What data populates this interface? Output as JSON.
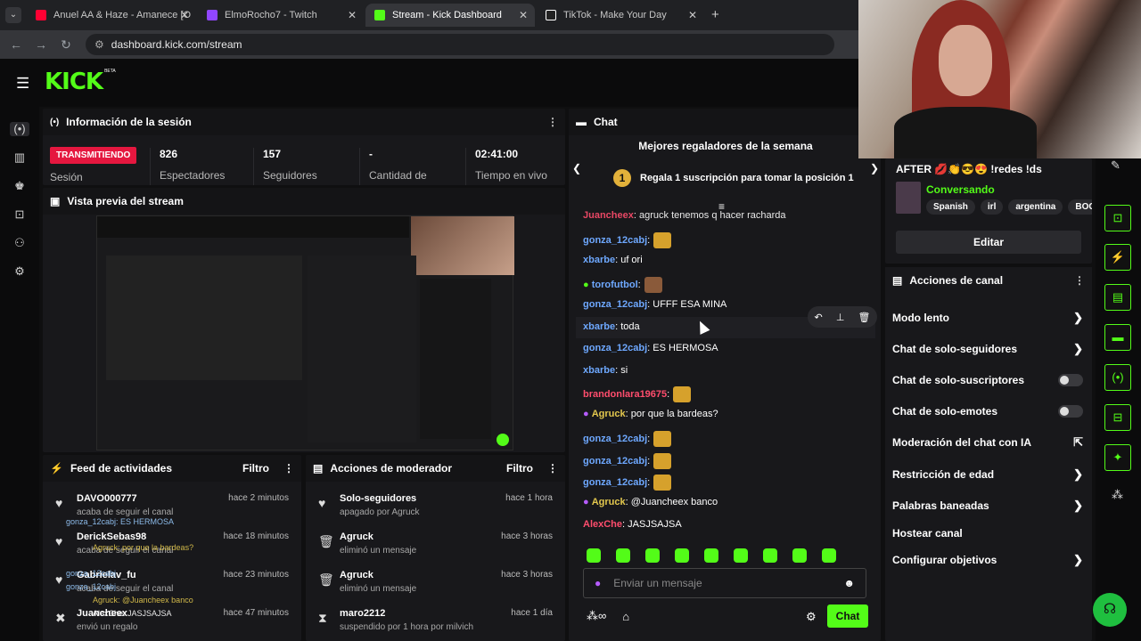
{
  "browser": {
    "tabs": [
      {
        "title": "Anuel AA & Haze - Amanece [O",
        "color": "#ff0033"
      },
      {
        "title": "ElmoRocho7 - Twitch",
        "color": "#9146ff"
      },
      {
        "title": "Stream - Kick Dashboard",
        "color": "#53fc18"
      },
      {
        "title": "TikTok - Make Your Day",
        "color": "#ffffff"
      }
    ],
    "url": "dashboard.kick.com/stream"
  },
  "kick": {
    "logo": "KICK",
    "beta": "BETA"
  },
  "session": {
    "title": "Información de la sesión",
    "status": "TRANSMITIENDO",
    "status_sub": "Sesión",
    "stats": [
      {
        "value": "826",
        "label": "Espectadores"
      },
      {
        "value": "157",
        "label": "Seguidores"
      },
      {
        "value": "-",
        "label": "Cantidad de"
      },
      {
        "value": "02:41:00",
        "label": "Tiempo en vivo"
      }
    ]
  },
  "preview": {
    "title": "Vista previa del stream"
  },
  "feed": {
    "title": "Feed de actividades",
    "filter": "Filtro",
    "rows": [
      {
        "name": "DAVO000777",
        "sub": "acaba de seguir el canal",
        "time": "hace 2 minutos"
      },
      {
        "name": "DerickSebas98",
        "sub": "acaba de seguir el canal",
        "time": "hace 18 minutos"
      },
      {
        "name": "Gabrielav_fu",
        "sub": "acaba de seguir el canal",
        "time": "hace 23 minutos"
      },
      {
        "name": "Juancheex",
        "sub": "envió un regalo",
        "time": "hace 47 minutos"
      }
    ],
    "overlay_lines": [
      "gonza_12cabj: ES HERMOSA",
      "Agruck: por que la bardeas?",
      "gonza_12cabj",
      "gonza_12cabj",
      "Agruck: @Juancheex banco",
      "AlexChe: JASJSAJSA"
    ]
  },
  "modactions": {
    "title": "Acciones de moderador",
    "filter": "Filtro",
    "rows": [
      {
        "name": "Solo-seguidores",
        "sub": "apagado por Agruck",
        "time": "hace 1 hora"
      },
      {
        "name": "Agruck",
        "sub": "eliminó un mensaje",
        "time": "hace 3 horas"
      },
      {
        "name": "Agruck",
        "sub": "eliminó un mensaje",
        "time": "hace 3 horas"
      },
      {
        "name": "maro2212",
        "sub": "suspendido por 1 hora por milvich",
        "time": "hace 1 día"
      }
    ]
  },
  "chat": {
    "title": "Chat",
    "gifters_title": "Mejores regaladores de la semana",
    "gifters_rank": "1",
    "gifters_cta": "Regala 1 suscripción para tomar la posición 1",
    "messages": [
      {
        "user": "Juancheex",
        "text": "agruck tenemos q hacer racharda",
        "color": "#ff4d6d"
      },
      {
        "user": "gonza_12cabj",
        "text": "",
        "color": "#6ea8ff",
        "emote": true
      },
      {
        "user": "xbarbe",
        "text": "uf ori",
        "color": "#6ea8ff"
      },
      {
        "user": "torofutbol",
        "text": "",
        "color": "#6ea8ff",
        "emote": true
      },
      {
        "user": "gonza_12cabj",
        "text": "UFFF ESA MINA",
        "color": "#6ea8ff"
      },
      {
        "user": "xbarbe",
        "text": "toda",
        "color": "#6ea8ff"
      },
      {
        "user": "gonza_12cabj",
        "text": "ES HERMOSA",
        "color": "#6ea8ff"
      },
      {
        "user": "xbarbe",
        "text": "si",
        "color": "#6ea8ff"
      },
      {
        "user": "brandonlara19675",
        "text": "",
        "color": "#ff4d6d",
        "emote": true
      },
      {
        "user": "Agruck",
        "text": "por que la bardeas?",
        "color": "#e3c84e"
      },
      {
        "user": "gonza_12cabj",
        "text": "",
        "color": "#6ea8ff",
        "emote": true
      },
      {
        "user": "gonza_12cabj",
        "text": "",
        "color": "#6ea8ff",
        "emote": true
      },
      {
        "user": "gonza_12cabj",
        "text": "",
        "color": "#6ea8ff",
        "emote": true
      },
      {
        "user": "Agruck",
        "text": "@Juancheex banco",
        "color": "#e3c84e"
      },
      {
        "user": "AlexChe",
        "text": "JASJSAJSA",
        "color": "#ff4d6d"
      }
    ],
    "input_placeholder": "Enviar un mensaje",
    "send_label": "Chat"
  },
  "streaminfo": {
    "title": "AFTER 💋👏😎😍 !redes !ds",
    "category": "Conversando",
    "tags": [
      "Spanish",
      "irl",
      "argentina",
      "BOC"
    ],
    "edit_label": "Editar"
  },
  "channel_actions": {
    "title": "Acciones de canal",
    "items": [
      {
        "label": "Modo lento",
        "control": "chevron"
      },
      {
        "label": "Chat de solo-seguidores",
        "control": "chevron"
      },
      {
        "label": "Chat de solo-suscriptores",
        "control": "toggle"
      },
      {
        "label": "Chat de solo-emotes",
        "control": "toggle"
      },
      {
        "label": "Moderación del chat con IA",
        "control": "external"
      },
      {
        "label": "Restricción de edad",
        "control": "chevron"
      },
      {
        "label": "Palabras baneadas",
        "control": "chevron"
      },
      {
        "label": "Hostear canal",
        "control": "none"
      },
      {
        "label": "Configurar objetivos",
        "control": "chevron"
      }
    ]
  },
  "colors": {
    "brand": "#53fc18",
    "live": "#e5173f"
  }
}
